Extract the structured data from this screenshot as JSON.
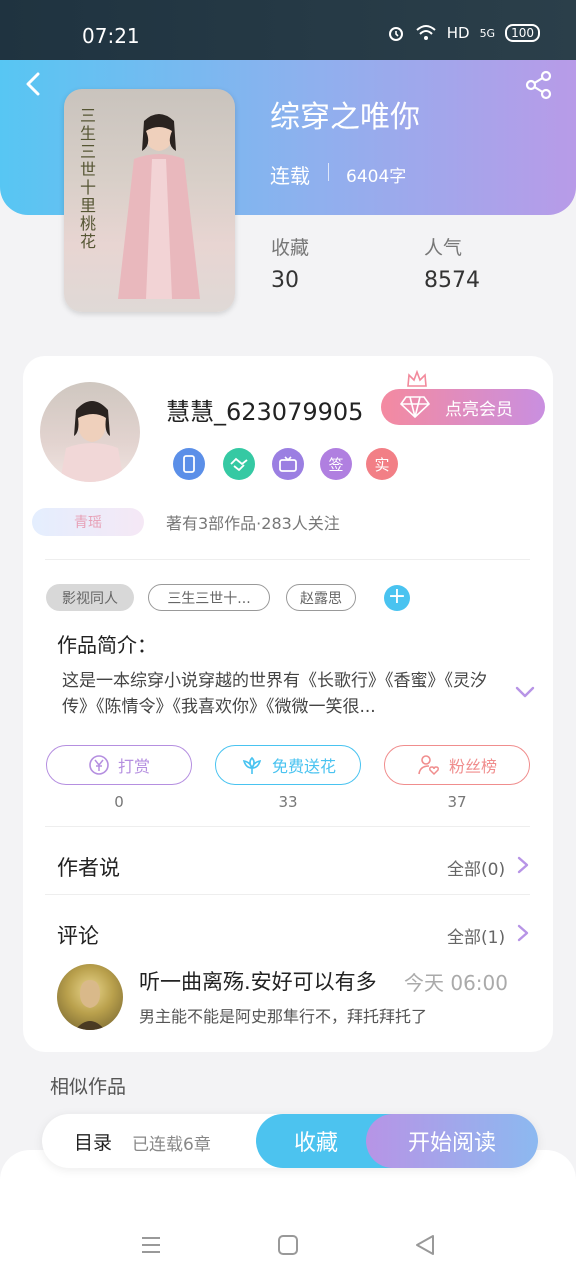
{
  "status_bar": {
    "time": "07:21",
    "network": "HD",
    "signal": "5G",
    "battery": "100"
  },
  "book": {
    "title": "综穿之唯你",
    "status": "连载",
    "word_count": "6404字",
    "cover_text": "三生三世十里桃花",
    "stats": [
      {
        "label": "收藏",
        "value": "30"
      },
      {
        "label": "人气",
        "value": "8574"
      }
    ]
  },
  "author": {
    "name": "慧慧_623079905",
    "vip_button": "点亮会员",
    "badges": [
      "签",
      "实"
    ],
    "level": "青瑶",
    "meta": "著有3部作品·283人关注"
  },
  "tags": [
    "影视同人",
    "三生三世十...",
    "赵露思"
  ],
  "intro": {
    "title": "作品简介：",
    "text": "这是一本综穿小说穿越的世界有《长歌行》《香蜜》《灵汐传》《陈情令》《我喜欢你》《微微一笑很..."
  },
  "actions": [
    {
      "label": "打赏",
      "count": "0",
      "color": "#b58fe0"
    },
    {
      "label": "免费送花",
      "count": "33",
      "color": "#49c3f0"
    },
    {
      "label": "粉丝榜",
      "count": "37",
      "color": "#f08d8d"
    }
  ],
  "author_says": {
    "title": "作者说",
    "more": "全部(0)"
  },
  "comments": {
    "title": "评论",
    "more": "全部(1)",
    "items": [
      {
        "user": "听一曲离殇.安好可以有多",
        "time": "今天 06:00",
        "text": "男主能不能是阿史那隼行不，拜托拜托了"
      }
    ]
  },
  "similar_title": "相似作品",
  "bottom_bar": {
    "toc_label": "目录",
    "toc_sub": "已连载6章",
    "collect": "收藏",
    "read": "开始阅读"
  },
  "colors": {
    "accent_blue": "#4cc3ef",
    "accent_purple": "#b794e6",
    "vip_pink": "#f48aa0"
  }
}
